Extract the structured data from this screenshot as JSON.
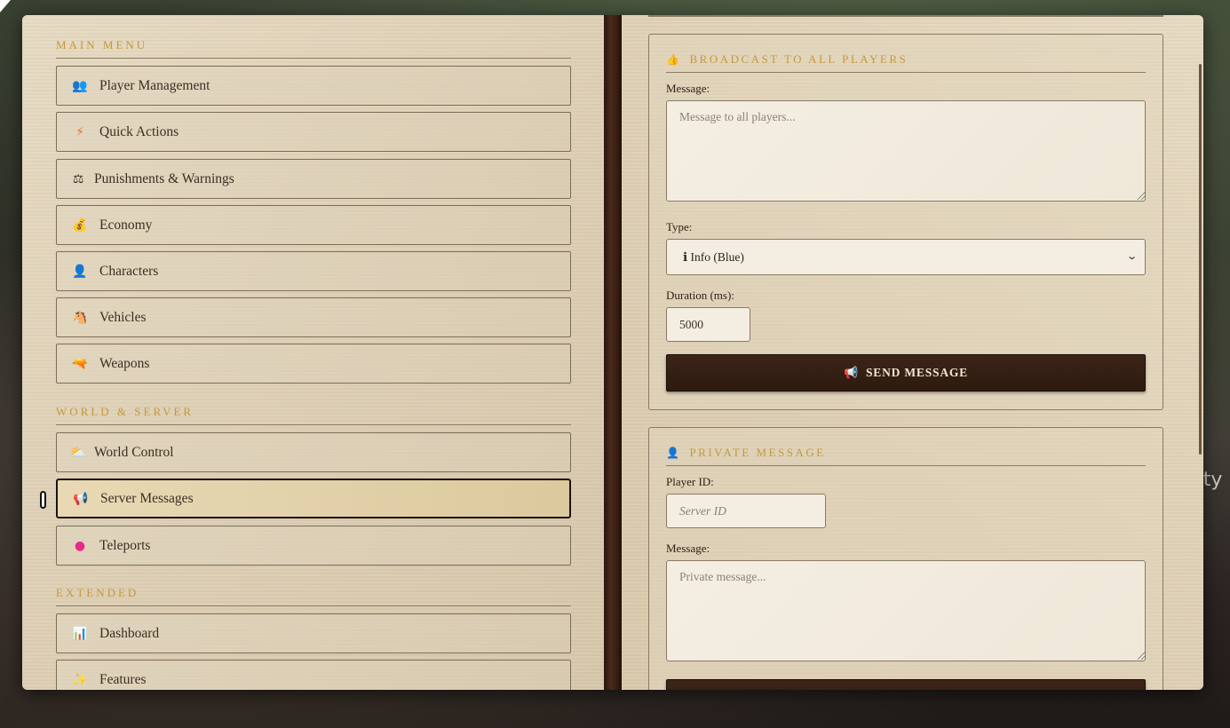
{
  "background": {
    "overlay_text": "tity"
  },
  "sidebar": {
    "sections": [
      {
        "title": "MAIN MENU",
        "items": [
          {
            "label": "Player Management",
            "icon": "👥",
            "icon_name": "users-icon",
            "icon_color": "#5a3a6e"
          },
          {
            "label": "Quick Actions",
            "icon": "⚡",
            "icon_name": "lightning-icon",
            "icon_color": "#e8703a"
          },
          {
            "label": "Punishments & Warnings",
            "icon": "⚖",
            "icon_name": "scales-icon",
            "icon_color": "#3b2e22"
          },
          {
            "label": "Economy",
            "icon": "💰",
            "icon_name": "money-bag-icon",
            "icon_color": "#d9a23e"
          },
          {
            "label": "Characters",
            "icon": "👤",
            "icon_name": "person-icon",
            "icon_color": "#5a3a6e"
          },
          {
            "label": "Vehicles",
            "icon": "🐴",
            "icon_name": "horse-icon",
            "icon_color": "#6b3f22"
          },
          {
            "label": "Weapons",
            "icon": "🔫",
            "icon_name": "pistol-icon",
            "icon_color": "#c8b43a"
          }
        ]
      },
      {
        "title": "WORLD & SERVER",
        "items": [
          {
            "label": "World Control",
            "icon": "⛅",
            "icon_name": "weather-icon",
            "icon_color": "#6a6a6a"
          },
          {
            "label": "Server Messages",
            "icon": "📢",
            "icon_name": "megaphone-icon",
            "icon_color": "#d63a3a",
            "active": true
          },
          {
            "label": "Teleports",
            "icon": "●",
            "icon_name": "pin-icon",
            "icon_color": "#e8288a"
          }
        ]
      },
      {
        "title": "EXTENDED",
        "items": [
          {
            "label": "Dashboard",
            "icon": "📊",
            "icon_name": "chart-icon",
            "icon_color": "#3a8ad6"
          },
          {
            "label": "Features",
            "icon": "✨",
            "icon_name": "sparkles-icon",
            "icon_color": "#e8c23a"
          }
        ]
      }
    ]
  },
  "broadcast": {
    "title": "BROADCAST TO ALL PLAYERS",
    "icon": "👍",
    "message_label": "Message:",
    "message_placeholder": "Message to all players...",
    "message_value": "",
    "type_label": "Type:",
    "type_selected": "ℹ Info (Blue)",
    "duration_label": "Duration (ms):",
    "duration_value": "5000",
    "send_label": "SEND MESSAGE",
    "send_icon": "📢"
  },
  "private": {
    "title": "PRIVATE MESSAGE",
    "icon": "👤",
    "player_id_label": "Player ID:",
    "player_id_placeholder": "Server ID",
    "message_label": "Message:",
    "message_placeholder": "Private message..."
  },
  "colors": {
    "accent_gold": "#c39a3a",
    "button_dark": "#2e1a10",
    "page_parchment": "#e4d6bc"
  }
}
